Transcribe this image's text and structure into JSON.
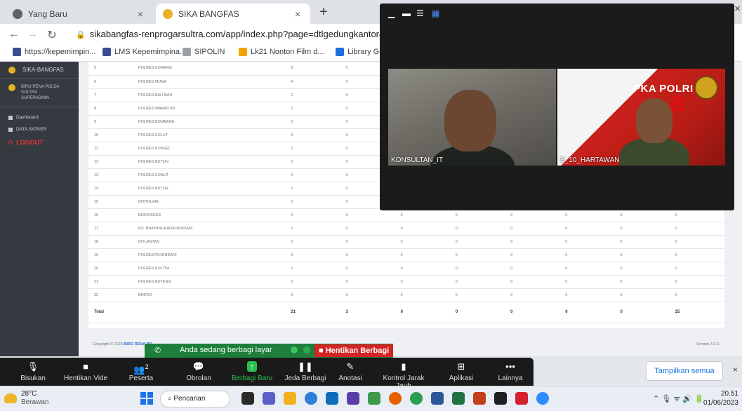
{
  "browser": {
    "tabs": [
      {
        "title": "Yang Baru",
        "active": false
      },
      {
        "title": "SIKA BANGFAS",
        "active": true
      }
    ],
    "close_glyph": "×",
    "new_tab_glyph": "+",
    "url": "sikabangfas-renprogarsultra.com/app/index.php?page=dtlgedungkantor&sasaran",
    "bookmarks": [
      {
        "label": "https://kepemimpin...",
        "icon": "rdo-icon"
      },
      {
        "label": "LMS Kepemimpina...",
        "icon": "rdo-icon"
      },
      {
        "label": "SIPOLIN",
        "icon": "sipolin-icon"
      },
      {
        "label": "Lk21 Nonton Film d...",
        "icon": "lk21-icon"
      },
      {
        "label": "Library Gene",
        "icon": "library-icon"
      }
    ]
  },
  "sidebar": {
    "brand": "SIKA-BANGFAS",
    "user_line1": "BIRO RENA POLDA SULTRA",
    "user_line2": "SUPERADMIN",
    "menu": [
      {
        "label": "Dashboard"
      },
      {
        "label": "DATA SATKER"
      },
      {
        "label": "LOGOUT"
      }
    ]
  },
  "table": {
    "rows": [
      {
        "no": "5",
        "name": "POLRES KONAWE",
        "v1": "3",
        "v2": "0",
        "v3": "0"
      },
      {
        "no": "6",
        "name": "POLRES MUNA",
        "v1": "4",
        "v2": "0",
        "v3": "0"
      },
      {
        "no": "7",
        "name": "POLRES BAU-BAU",
        "v1": "2",
        "v2": "0",
        "v3": "0"
      },
      {
        "no": "8",
        "name": "POLRES WAKATOBI",
        "v1": "2",
        "v2": "0",
        "v3": "0"
      },
      {
        "no": "9",
        "name": "POLRES BOMBANA",
        "v1": "0",
        "v2": "0",
        "v3": "0"
      },
      {
        "no": "10",
        "name": "POLRES KOLUT",
        "v1": "3",
        "v2": "0",
        "v3": "0"
      },
      {
        "no": "11",
        "name": "POLRES KONSEL",
        "v1": "2",
        "v2": "0",
        "v3": "0"
      },
      {
        "no": "12",
        "name": "POLRES BUTON",
        "v1": "0",
        "v2": "0",
        "v3": "0"
      },
      {
        "no": "13",
        "name": "POLRES KONUT",
        "v1": "0",
        "v2": "0",
        "v3": "0"
      },
      {
        "no": "14",
        "name": "POLRES BUTUR",
        "v1": "0",
        "v2": "0",
        "v3": "0"
      },
      {
        "no": "15",
        "name": "DITPOLAIR",
        "v1": "0",
        "v2": "0",
        "v3": "0"
      },
      {
        "no": "16",
        "name": "BIDDOKKES",
        "v1": "0",
        "v2": "0",
        "v3": "0"
      },
      {
        "no": "17",
        "name": "RS. BHAYANGKARA KENDARI",
        "v1": "0",
        "v2": "0",
        "v3": "0"
      },
      {
        "no": "18",
        "name": "DITLANTAS",
        "v1": "0",
        "v2": "0",
        "v3": "0"
      },
      {
        "no": "19",
        "name": "POLRESTA KENDARI",
        "v1": "0",
        "v2": "0",
        "v3": "0"
      },
      {
        "no": "20",
        "name": "POLRES KOLTIM",
        "v1": "0",
        "v2": "0",
        "v3": "0"
      },
      {
        "no": "21",
        "name": "POLRES BUTENG",
        "v1": "0",
        "v2": "0",
        "v3": "0"
      },
      {
        "no": "22",
        "name": "BINTEK",
        "v1": "0",
        "v2": "0",
        "v3": "0"
      }
    ],
    "extra_zero": "0",
    "total": {
      "label": "Total",
      "values": [
        "21",
        "3",
        "0",
        "0",
        "0",
        "0",
        "0",
        "25"
      ]
    },
    "footer_left": "Copyright © 2023",
    "footer_brand": "BIRO RENA PO",
    "footer_right": "Version 3.2.0"
  },
  "video": {
    "participants": [
      {
        "name": "KONSULTAN_IT"
      },
      {
        "name": "B_10_HARTAWAN"
      }
    ],
    "banner_text": "PKA POLRI",
    "banner_letter": "B"
  },
  "share": {
    "message": "Anda sedang berbagi layar",
    "stop_label": "Hentikan Berbagi"
  },
  "zoom_toolbar": [
    {
      "label": "Bisukan",
      "icon": "microphone-icon",
      "glyph": "🎙"
    },
    {
      "label": "Hentikan Vide",
      "icon": "video-camera-icon",
      "glyph": "■"
    },
    {
      "label": "Peserta",
      "icon": "participants-icon",
      "glyph": "👥",
      "count": "2"
    },
    {
      "label": "Obrolan",
      "icon": "chat-icon",
      "glyph": "💬"
    },
    {
      "label": "Berbagi Baru",
      "icon": "share-screen-icon",
      "glyph": "↑"
    },
    {
      "label": "Jeda Berbagi",
      "icon": "pause-icon",
      "glyph": "❚❚"
    },
    {
      "label": "Anotasi",
      "icon": "pen-icon",
      "glyph": "✎"
    },
    {
      "label": "Kontrol Jarak Jauh",
      "icon": "mouse-icon",
      "glyph": "▮"
    },
    {
      "label": "Aplikasi",
      "icon": "apps-icon",
      "glyph": "⊞"
    },
    {
      "label": "Lainnya",
      "icon": "more-icon",
      "glyph": "•••"
    }
  ],
  "download_bar": {
    "show_all": "Tampilkan semua",
    "close_glyph": "×"
  },
  "taskbar": {
    "temperature": "28°C",
    "weather": "Berawan",
    "search": "Pencarian",
    "time": "20.51",
    "date": "01/06/2023"
  }
}
